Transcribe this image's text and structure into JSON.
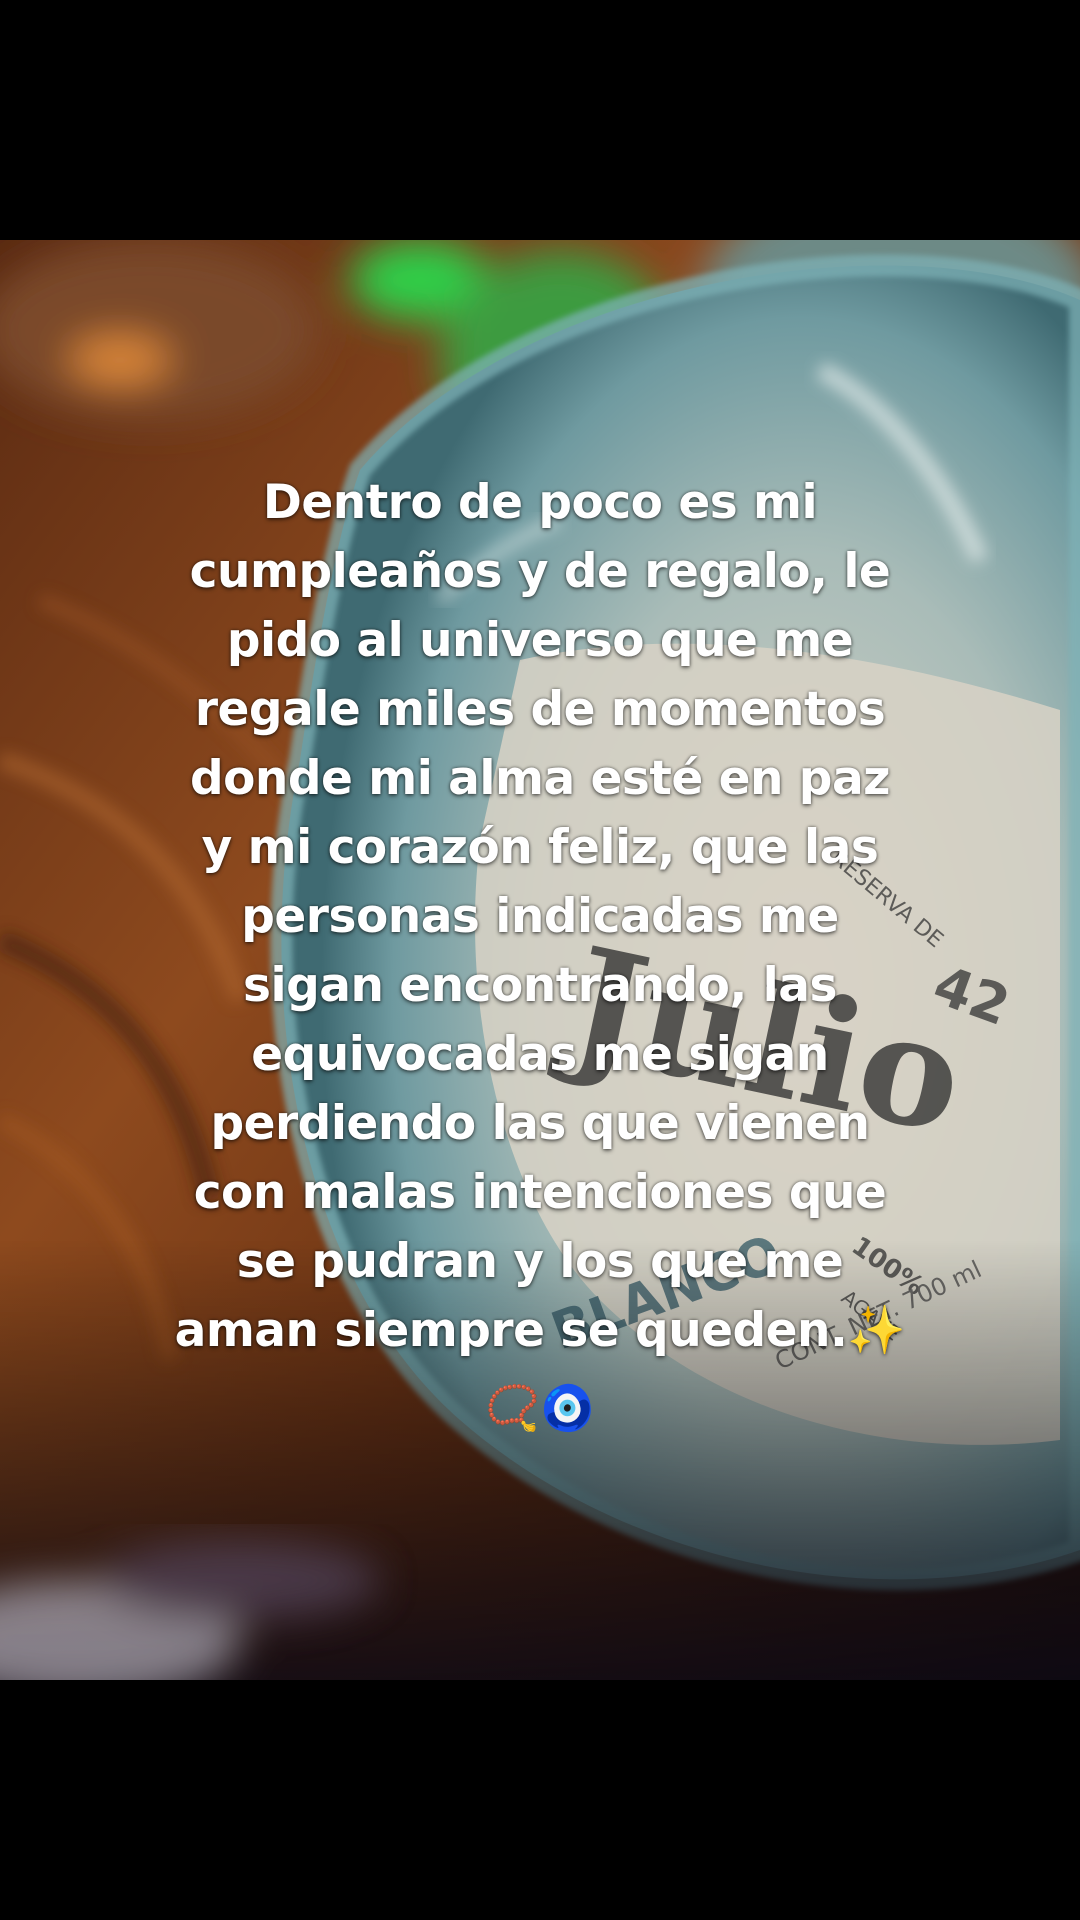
{
  "caption": {
    "lines": [
      "Dentro de poco es mi",
      "cumpleaños y de regalo, le",
      "pido al universo que me",
      "regale miles de momentos",
      "donde mi alma esté en paz",
      "y mi corazón feliz, que las",
      "personas indicadas me",
      "sigan encontrando, las",
      "equivocadas me sigan",
      "perdiendo las que vienen",
      "con malas intenciones que",
      "se pudran y los que me",
      "aman siempre se queden.✨"
    ],
    "emojis": "📿🧿"
  },
  "photo": {
    "label_text": [
      "42",
      "Julio",
      "100%",
      "AGAVE",
      "CONT. NET. 700 ml",
      "BLANCO",
      "RESERVA DE"
    ]
  },
  "colors": {
    "background": "#000000",
    "caption_text": "#ffffff",
    "wood": "#7a3c17",
    "bottle_glass": "#9fc4c4"
  }
}
